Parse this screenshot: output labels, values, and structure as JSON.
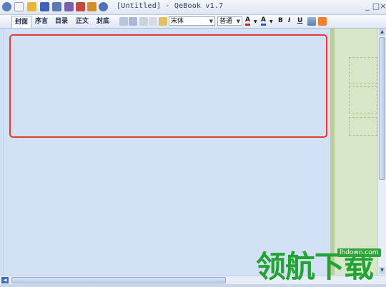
{
  "window": {
    "title": "[Untitled] - QeBook v1.7",
    "minimize_glyph": "_",
    "maximize_glyph": "□",
    "close_glyph": "×"
  },
  "quick_access": [
    {
      "name": "app-menu-icon",
      "color": "#5b7fbd"
    },
    {
      "name": "new-file-icon",
      "color": "#f2f2f2"
    },
    {
      "name": "open-folder-icon",
      "color": "#e8b534"
    },
    {
      "name": "save-icon",
      "color": "#3a63b5"
    },
    {
      "name": "save-as-icon",
      "color": "#5c79b3"
    },
    {
      "name": "export-icon",
      "color": "#7d5fb0"
    },
    {
      "name": "compile-icon",
      "color": "#c24a3a"
    },
    {
      "name": "home-icon",
      "color": "#d98c2b"
    },
    {
      "name": "help-icon",
      "color": "#4f72b8"
    }
  ],
  "tabs": [
    {
      "label": "封面",
      "active": true
    },
    {
      "label": "序言",
      "active": false
    },
    {
      "label": "目录",
      "active": false
    },
    {
      "label": "正文",
      "active": false
    },
    {
      "label": "封底",
      "active": false
    }
  ],
  "font_combo": {
    "value": "宋体"
  },
  "style_combo": {
    "value": "普通"
  },
  "format_buttons": {
    "bold": "B",
    "italic": "I",
    "underline": "U",
    "font_color": "A",
    "highlight": "A"
  },
  "colors": {
    "highlight_border": "#e23a3a",
    "editor_bg": "#d3e1f5",
    "side_panel_bg": "#d7e6c6",
    "watermark_green": "#22a334"
  },
  "watermark": {
    "text": "领航下载",
    "url": "lhdown.com"
  }
}
